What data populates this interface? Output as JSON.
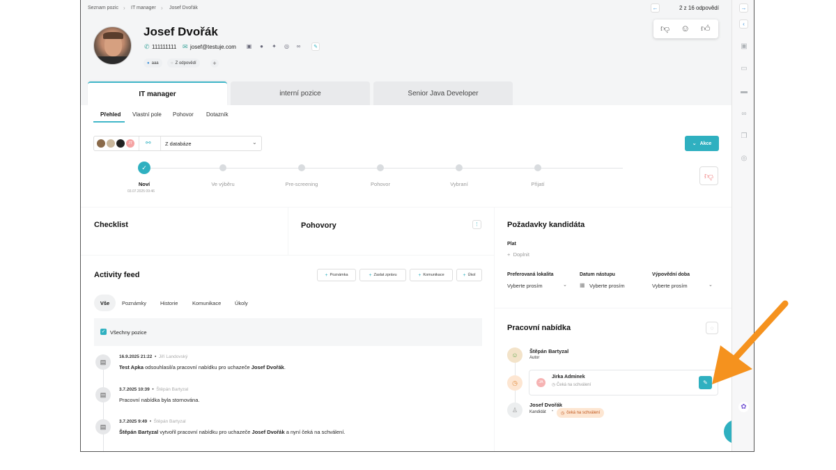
{
  "breadcrumb": [
    "Seznam pozic",
    "IT manager",
    "Josef Dvořák"
  ],
  "pager": "2 z 16 odpovědí",
  "candidate": {
    "name": "Josef Dvořák",
    "phone": "111111111",
    "email": "josef@testuje.com",
    "tags": [
      "aaa",
      "Z odpovědí"
    ]
  },
  "position_tabs": [
    "IT manager",
    "interní pozice",
    "Senior Java Developer"
  ],
  "sub_tabs": [
    "Přehled",
    "Vlastní pole",
    "Pohovor",
    "Dotazník"
  ],
  "source_select": "Z databáze",
  "akce_label": "Akce",
  "stages": [
    {
      "label": "Noví",
      "date": "03.07.2025 09:46",
      "active": true
    },
    {
      "label": "Ve výběru"
    },
    {
      "label": "Pre-screening"
    },
    {
      "label": "Pohovor"
    },
    {
      "label": "Vybraní"
    },
    {
      "label": "Přijatí"
    }
  ],
  "checklist_title": "Checklist",
  "pohovory_title": "Pohovory",
  "activity": {
    "title": "Activity feed",
    "buttons": [
      "Poznámka",
      "Zaslat zprávu",
      "Komunikace",
      "Úkol"
    ],
    "tabs": [
      "Vše",
      "Poznámky",
      "Historie",
      "Komunikace",
      "Úkoly"
    ],
    "filter_label": "Všechny pozice",
    "items": [
      {
        "date": "16.9.2025 21:22",
        "author": "Jiří Landovský",
        "pre": "Test Apka",
        "mid": " odsouhlasil/a pracovní nabídku pro uchazeče ",
        "name": "Josef Dvořák",
        "post": "."
      },
      {
        "date": "3.7.2025 10:39",
        "author": "Štěpán Bartyzal",
        "pre": "",
        "mid": "Pracovní nabídka byla stornována.",
        "name": "",
        "post": ""
      },
      {
        "date": "3.7.2025 9:49",
        "author": "Štěpán Bartyzal",
        "pre": "Štěpán Bartyzal",
        "mid": " vytvořil pracovní nabídku pro uchazeče ",
        "name": "Josef Dvořák",
        "post": " a nyní čeká na schválení."
      }
    ]
  },
  "requirements": {
    "title": "Požadavky kandidáta",
    "salary_label": "Plat",
    "salary_add": "Doplnit",
    "location_label": "Preferovaná lokalita",
    "location_value": "Vyberte prosím",
    "start_label": "Datum nástupu",
    "start_value": "Vyberte prosím",
    "notice_label": "Výpovědní doba",
    "notice_value": "Vyberte prosím"
  },
  "offer": {
    "title": "Pracovní nabídka",
    "author_name": "Štěpán Bartyzal",
    "author_role": "Autor",
    "approver_initials": "JA",
    "approver_name": "Jirka Adminek",
    "approver_status": "Čeká na schválení",
    "candidate_name": "Josef Dvořák",
    "candidate_role": "Kandidát",
    "candidate_status": "čeká na schválení"
  },
  "colors": {
    "accent": "#2fb0c0",
    "arrow": "#f5921e"
  }
}
